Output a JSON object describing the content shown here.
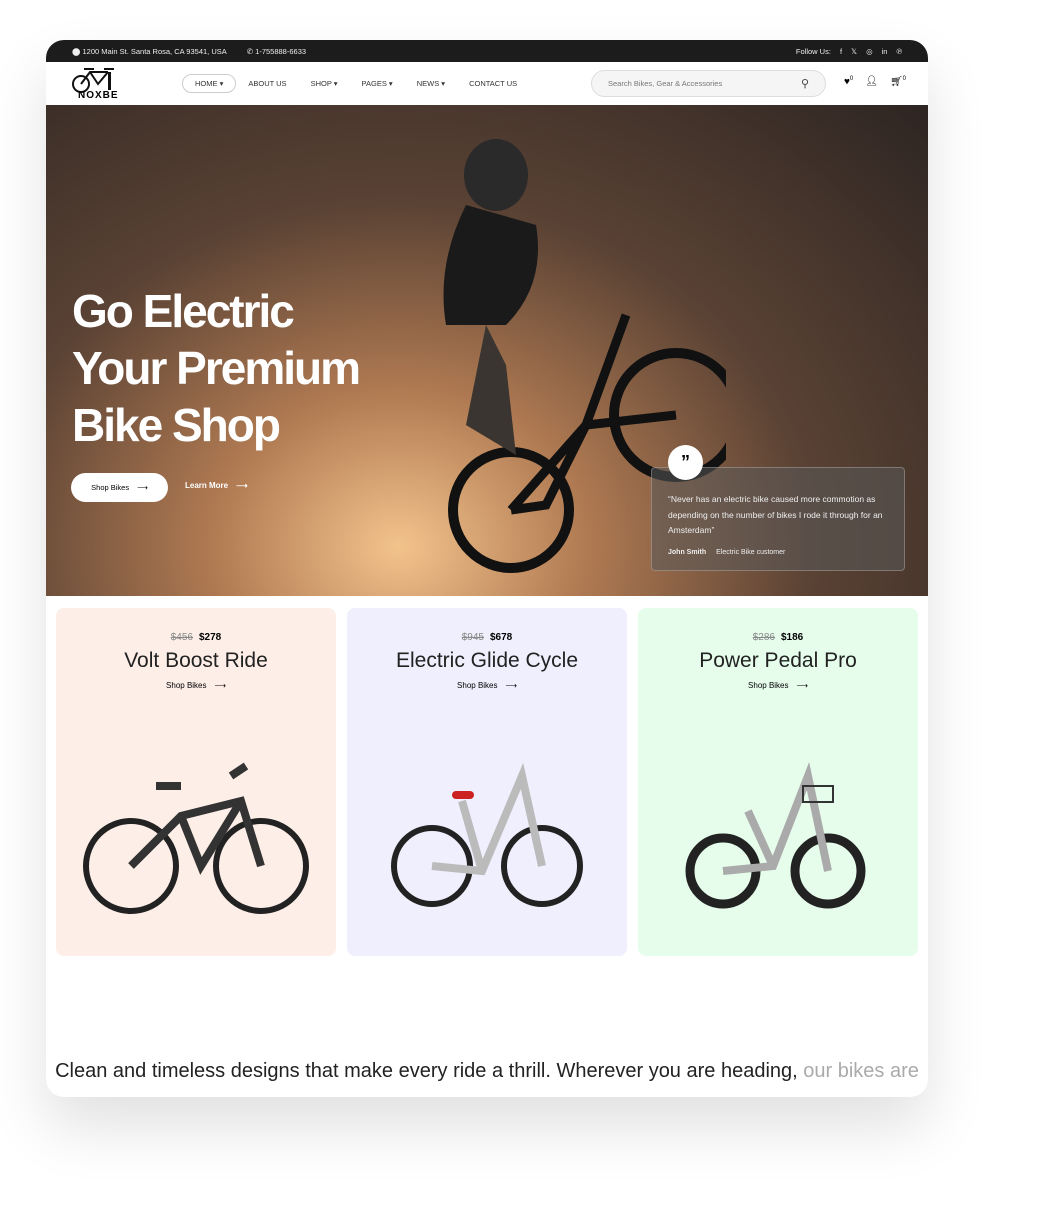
{
  "topbar": {
    "address": "1200 Main St. Santa Rosa, CA 93541, USA",
    "phone": "1-755888-6633",
    "follow": "Follow Us:",
    "social": [
      "facebook-icon",
      "x-icon",
      "instagram-icon",
      "linkedin-icon",
      "pinterest-icon"
    ]
  },
  "nav": {
    "logo": "NOXBE",
    "items": [
      "HOME",
      "ABOUT US",
      "SHOP",
      "PAGES",
      "NEWS",
      "CONTACT US"
    ],
    "search_placeholder": "Search Bikes, Gear & Accessories",
    "wishlist_count": "0",
    "cart_count": "0"
  },
  "hero": {
    "title_lines": [
      "Go Electric",
      "Your Premium",
      "Bike Shop"
    ],
    "primary_button": "Shop Bikes",
    "secondary_button": "Learn More",
    "quote": {
      "text": "“Never has an electric bike caused more commotion as depending on the number of bikes I rode it through for an Amsterdam”",
      "author": "John Smith",
      "role": "Electric Bike customer"
    }
  },
  "products": [
    {
      "old_price": "$456",
      "price": "$278",
      "name": "Volt Boost Ride",
      "link": "Shop Bikes",
      "bg": "#fdeee8"
    },
    {
      "old_price": "$945",
      "price": "$678",
      "name": "Electric Glide Cycle",
      "link": "Shop Bikes",
      "bg": "#efeffd"
    },
    {
      "old_price": "$286",
      "price": "$186",
      "name": "Power Pedal Pro",
      "link": "Shop Bikes",
      "bg": "#e6fdec"
    }
  ],
  "tagline": {
    "main": "Clean and timeless designs that make every ride a thrill. Wherever you are heading,",
    "faded": "our bikes are"
  }
}
